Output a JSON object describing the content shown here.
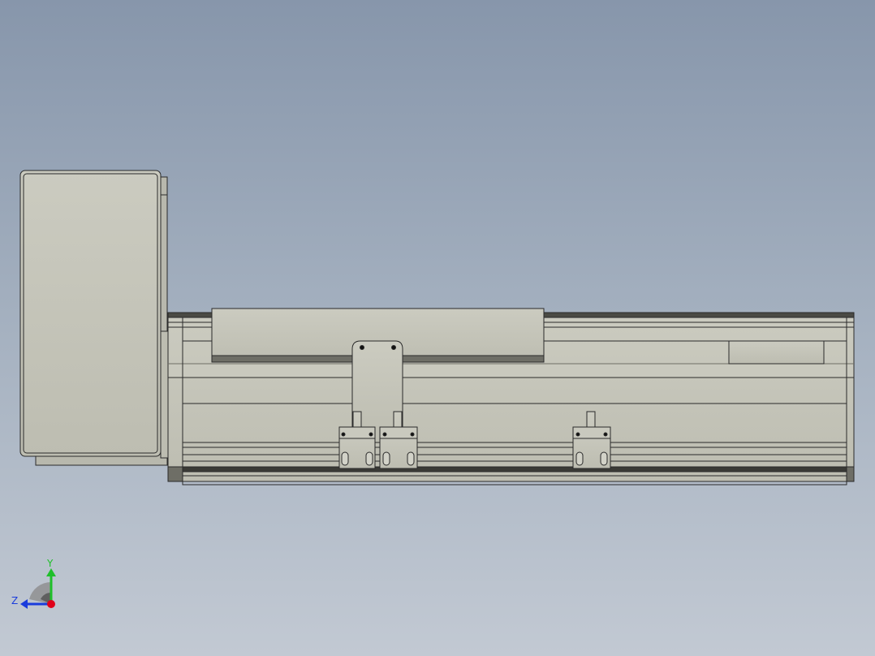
{
  "viewport": {
    "background_top": "#8796ab",
    "background_bottom": "#c2c9d3"
  },
  "model": {
    "part_fill": "#c4c4b8",
    "edge_color": "#2a2a2a",
    "dark_fill": "#6e6e66"
  },
  "triad": {
    "x_axis_color": "#e0001a",
    "y_axis_color": "#1fbf2a",
    "z_axis_color": "#1a3cdc",
    "y_label": "Y",
    "z_label": "Z"
  }
}
